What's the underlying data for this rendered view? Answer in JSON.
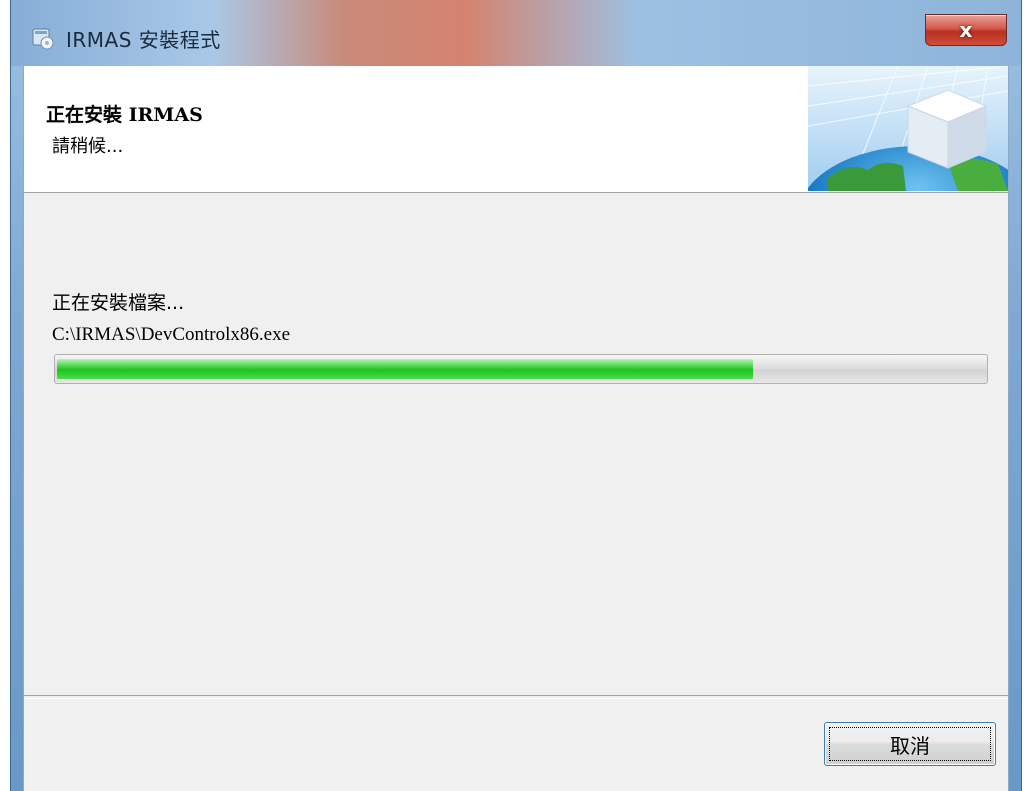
{
  "window": {
    "title": "IRMAS 安裝程式",
    "close_label": "x"
  },
  "banner": {
    "title": "正在安裝 IRMAS",
    "subtitle": "請稍候..."
  },
  "status": {
    "label": "正在安裝檔案...",
    "file_path": "C:\\IRMAS\\DevControlx86.exe",
    "progress_fraction": 0.75
  },
  "buttons": {
    "cancel_label": "取消"
  },
  "colors": {
    "progress_green": "#1ec41e",
    "close_red": "#c8402f",
    "button_focus_border": "#3c7fb1"
  },
  "icons": {
    "app": "installer-icon",
    "close": "close-icon",
    "banner": "globe-cube-icon"
  }
}
